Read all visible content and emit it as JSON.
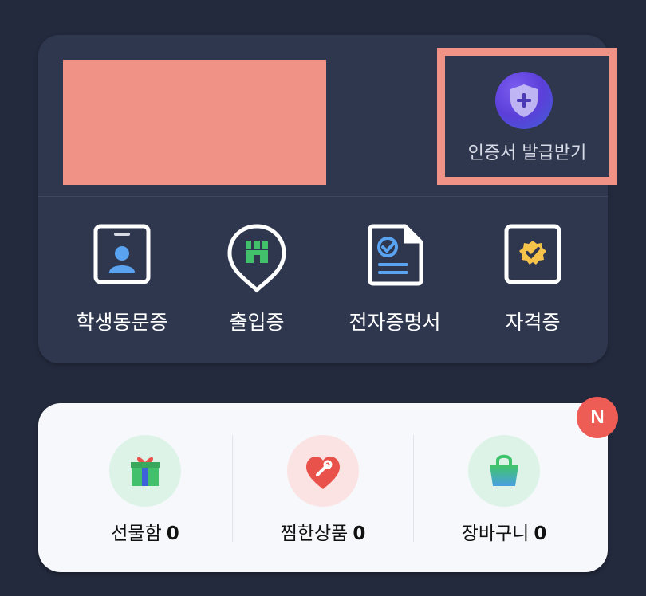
{
  "certificate": {
    "label": "인증서 발급받기",
    "icon": "shield-plus-icon",
    "highlight_color": "#f09285"
  },
  "redacted": {
    "color": "#f09285"
  },
  "menu": [
    {
      "label": "학생동문증",
      "icon": "student-id-card-icon"
    },
    {
      "label": "출입증",
      "icon": "entry-pass-icon"
    },
    {
      "label": "전자증명서",
      "icon": "e-certificate-icon"
    },
    {
      "label": "자격증",
      "icon": "license-icon"
    }
  ],
  "shop": {
    "badge": "N",
    "items": [
      {
        "label": "선물함",
        "count": "0",
        "icon": "gift-icon",
        "bg": "#ddf3e8"
      },
      {
        "label": "찜한상품",
        "count": "0",
        "icon": "heart-icon",
        "bg": "#fbe3e3"
      },
      {
        "label": "장바구니",
        "count": "0",
        "icon": "shopping-bag-icon",
        "bg": "#ddf3e8"
      }
    ]
  },
  "colors": {
    "background": "#232a3d",
    "card_dark": "#2f374f",
    "card_light": "#f6f8fb",
    "badge": "#ee5c56"
  }
}
